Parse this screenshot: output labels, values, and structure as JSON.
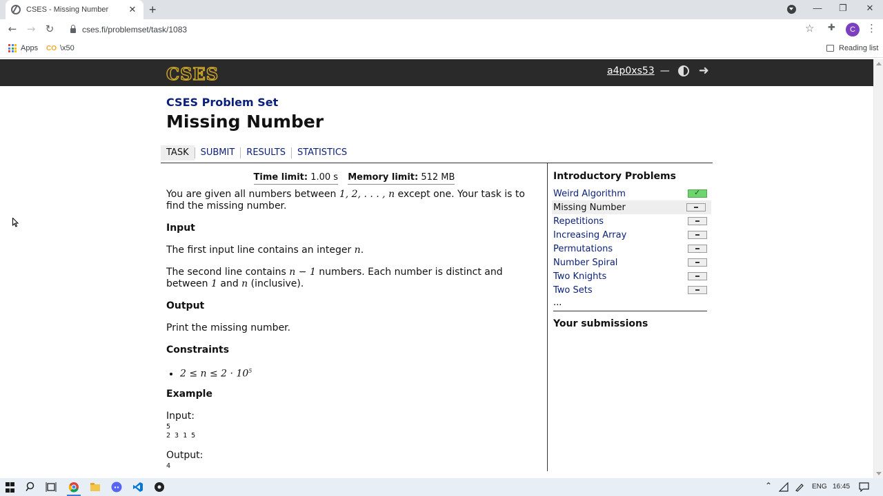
{
  "browser": {
    "tab_title": "CSES - Missing Number",
    "tab_close": "✕",
    "new_tab": "+",
    "url": "cses.fi/problemset/task/1083",
    "profile_initial": "C",
    "bookmarks": [
      {
        "label": "Apps"
      },
      {
        "label": "\\x50"
      }
    ],
    "reading_list": "Reading list",
    "window_controls": {
      "minimize": "—",
      "restore": "❐",
      "close": "✕"
    }
  },
  "site": {
    "logo": "CSES",
    "username": "a4p0xs53",
    "dash": "—",
    "accent": "#0a1f7a",
    "header_bg": "#2a2a2a"
  },
  "page": {
    "subtitle": "CSES Problem Set",
    "title": "Missing Number",
    "tabs": [
      "TASK",
      "SUBMIT",
      "RESULTS",
      "STATISTICS"
    ]
  },
  "task": {
    "time_limit_label": "Time limit:",
    "time_limit_value": "1.00 s",
    "memory_limit_label": "Memory limit:",
    "memory_limit_value": "512 MB",
    "statement_a": "You are given all numbers between ",
    "statement_math": "1, 2, . . . , n",
    "statement_b": " except one. Your task is to find the missing number.",
    "input_heading": "Input",
    "input_1a": "The first input line contains an integer ",
    "input_1_math": "n",
    "input_1b": ".",
    "input_2a": "The second line contains ",
    "input_2_math": "n − 1",
    "input_2b": " numbers. Each number is distinct and between ",
    "input_2_math2": "1",
    "input_2c": " and ",
    "input_2_math3": "n",
    "input_2d": " (inclusive).",
    "output_heading": "Output",
    "output_text": "Print the missing number.",
    "constraints_heading": "Constraints",
    "constraint": "2 ≤ n ≤ 2 · 10",
    "constraint_exp": "5",
    "example_heading": "Example",
    "example_input_label": "Input:",
    "example_input": "5\n2 3 1 5",
    "example_output_label": "Output:",
    "example_output": "4"
  },
  "sidebar": {
    "heading": "Introductory Problems",
    "problems": [
      {
        "name": "Weird Algorithm",
        "status": "done"
      },
      {
        "name": "Missing Number",
        "status": "none",
        "current": true
      },
      {
        "name": "Repetitions",
        "status": "none"
      },
      {
        "name": "Increasing Array",
        "status": "none"
      },
      {
        "name": "Permutations",
        "status": "none"
      },
      {
        "name": "Number Spiral",
        "status": "none"
      },
      {
        "name": "Two Knights",
        "status": "none"
      },
      {
        "name": "Two Sets",
        "status": "none"
      }
    ],
    "more": "...",
    "submissions_heading": "Your submissions"
  },
  "taskbar": {
    "language": "ENG",
    "time": "16:45"
  }
}
